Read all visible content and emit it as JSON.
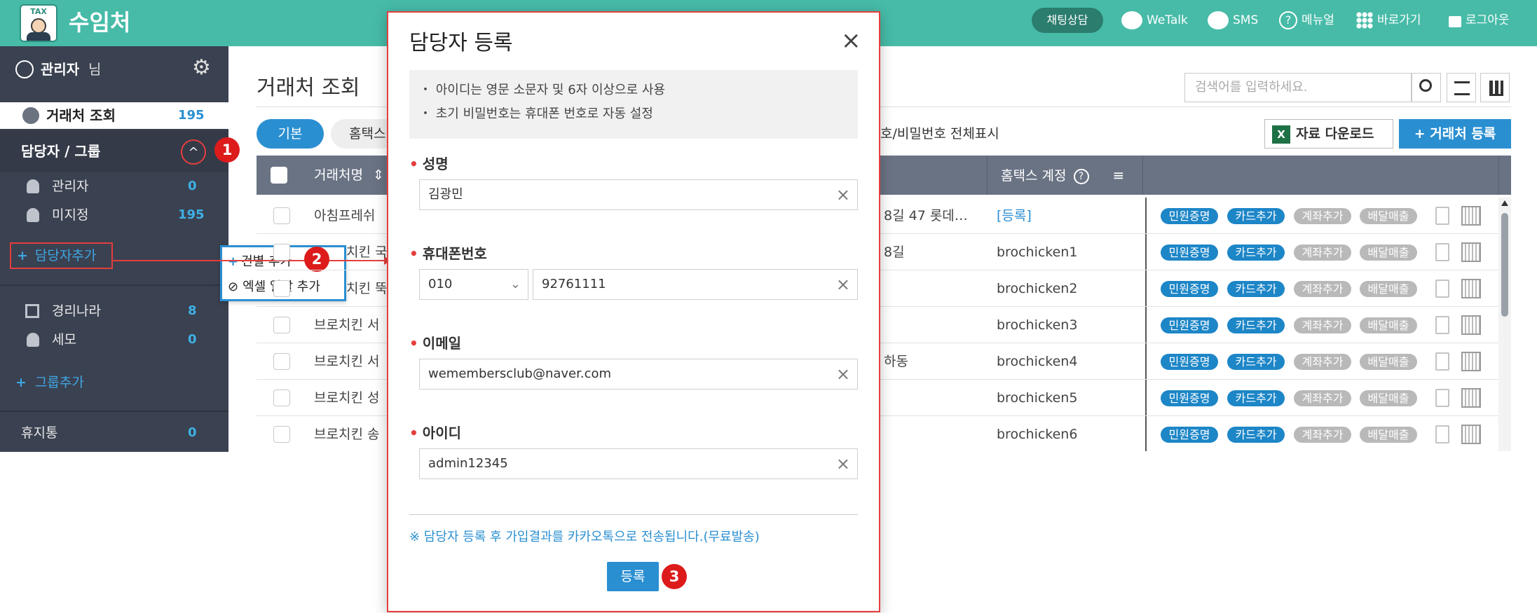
{
  "header": {
    "app_title": "수임처",
    "logo_text": "TAX",
    "chat_button": "채팅상담",
    "wetalk": "WeTalk",
    "sms": "SMS",
    "manual": "메뉴얼",
    "shortcut": "바로가기",
    "logout": "로그아웃"
  },
  "sidebar": {
    "user_name": "관리자",
    "user_suffix": "님",
    "client_search": "거래처 조회",
    "client_count": "195",
    "manager_group": "담당자 / 그룹",
    "managers": [
      {
        "label": "관리자",
        "count": "0"
      },
      {
        "label": "미지정",
        "count": "195"
      }
    ],
    "add_manager": "담당자추가",
    "groups": [
      {
        "label": "경리나라",
        "count": "8"
      },
      {
        "label": "세모",
        "count": "0"
      }
    ],
    "add_group": "그룹추가",
    "trash": "휴지통",
    "trash_count": "0"
  },
  "context_menu": {
    "single_add": "건별 추가",
    "excel_add": "엑셀 일괄 추가"
  },
  "main": {
    "title": "거래처 조회",
    "search_placeholder": "검색어를 입력하세요.",
    "tabs": {
      "basic": "기본",
      "hometax": "홈택스"
    },
    "show_all": "호/비밀번호 전체표시",
    "download": "자료 다운로드",
    "register": "거래처 등록",
    "columns": {
      "name": "거래처명",
      "hometax": "홈택스 계정"
    },
    "rows": [
      {
        "name": "아침프레쉬",
        "addr": "8길 47 롯데…",
        "account": "[등록]"
      },
      {
        "name": "치킨 국",
        "addr": "8길",
        "account": "brochicken1"
      },
      {
        "name": "치킨 뚝",
        "addr": "",
        "account": "brochicken2"
      },
      {
        "name": "브로치킨 서",
        "addr": "",
        "account": "brochicken3"
      },
      {
        "name": "브로치킨 서",
        "addr": "하동",
        "account": "brochicken4"
      },
      {
        "name": "브로치킨 성",
        "addr": "",
        "account": "brochicken5"
      },
      {
        "name": "브로치킨 송",
        "addr": "",
        "account": "brochicken6"
      }
    ],
    "badges": {
      "b1": "민원증명",
      "b2": "카드추가",
      "b3": "계좌추가",
      "b4": "배달매출"
    }
  },
  "modal": {
    "title": "담당자 등록",
    "notice1": "・ 아이디는 영문 소문자 및 6자 이상으로 사용",
    "notice2": "・ 초기 비밀번호는 휴대폰 번호로 자동 설정",
    "name_label": "성명",
    "name_value": "김광민",
    "phone_label": "휴대폰번호",
    "phone_prefix": "010",
    "phone_value": "92761111",
    "email_label": "이메일",
    "email_value": "wemembersclub@naver.com",
    "id_label": "아이디",
    "id_value": "admin12345",
    "kakao_note": "※ 담당자 등록 후 가입결과를 카카오톡으로 전송됩니다.(무료발송)",
    "submit": "등록"
  },
  "annotations": {
    "step1": "1",
    "step2": "2",
    "step3": "3"
  },
  "colors": {
    "header": "#47bba8",
    "sidebar": "#3a4150",
    "accent": "#3fa6e4",
    "marker": "#dd1b1b"
  }
}
